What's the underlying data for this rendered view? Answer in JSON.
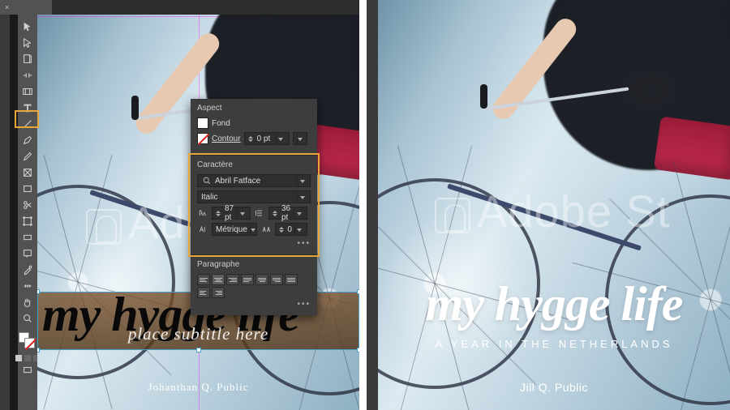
{
  "tab": {
    "close_glyph": "×"
  },
  "tools": [
    "selection",
    "direct-selection",
    "page",
    "gap",
    "content-collector",
    "type",
    "line",
    "pen",
    "pencil",
    "frame",
    "rectangle",
    "scissors",
    "free-transform",
    "gradient-swatch",
    "note",
    "eyedropper",
    "measure",
    "hand",
    "zoom"
  ],
  "panel": {
    "aspect": {
      "title": "Aspect",
      "fill_label": "Fond",
      "stroke_label": "Contour",
      "stroke_weight": "0 pt"
    },
    "character": {
      "title": "Caractère",
      "font_family": "Abril Fatface",
      "font_style": "Italic",
      "font_size": "87 pt",
      "leading": "36 pt",
      "kerning": "Métrique",
      "tracking": "0"
    },
    "paragraph": {
      "title": "Paragraphe",
      "more": "•••"
    }
  },
  "left_page": {
    "watermark": "Adobe",
    "title": "my hygge life",
    "subtitle_placeholder": "place subtitle here",
    "author": "Johanthan Q. Public"
  },
  "right_page": {
    "watermark": "Adobe St",
    "title": "my hygge life",
    "subtitle": "A YEAR IN THE NETHERLANDS",
    "author": "Jill Q. Public"
  }
}
